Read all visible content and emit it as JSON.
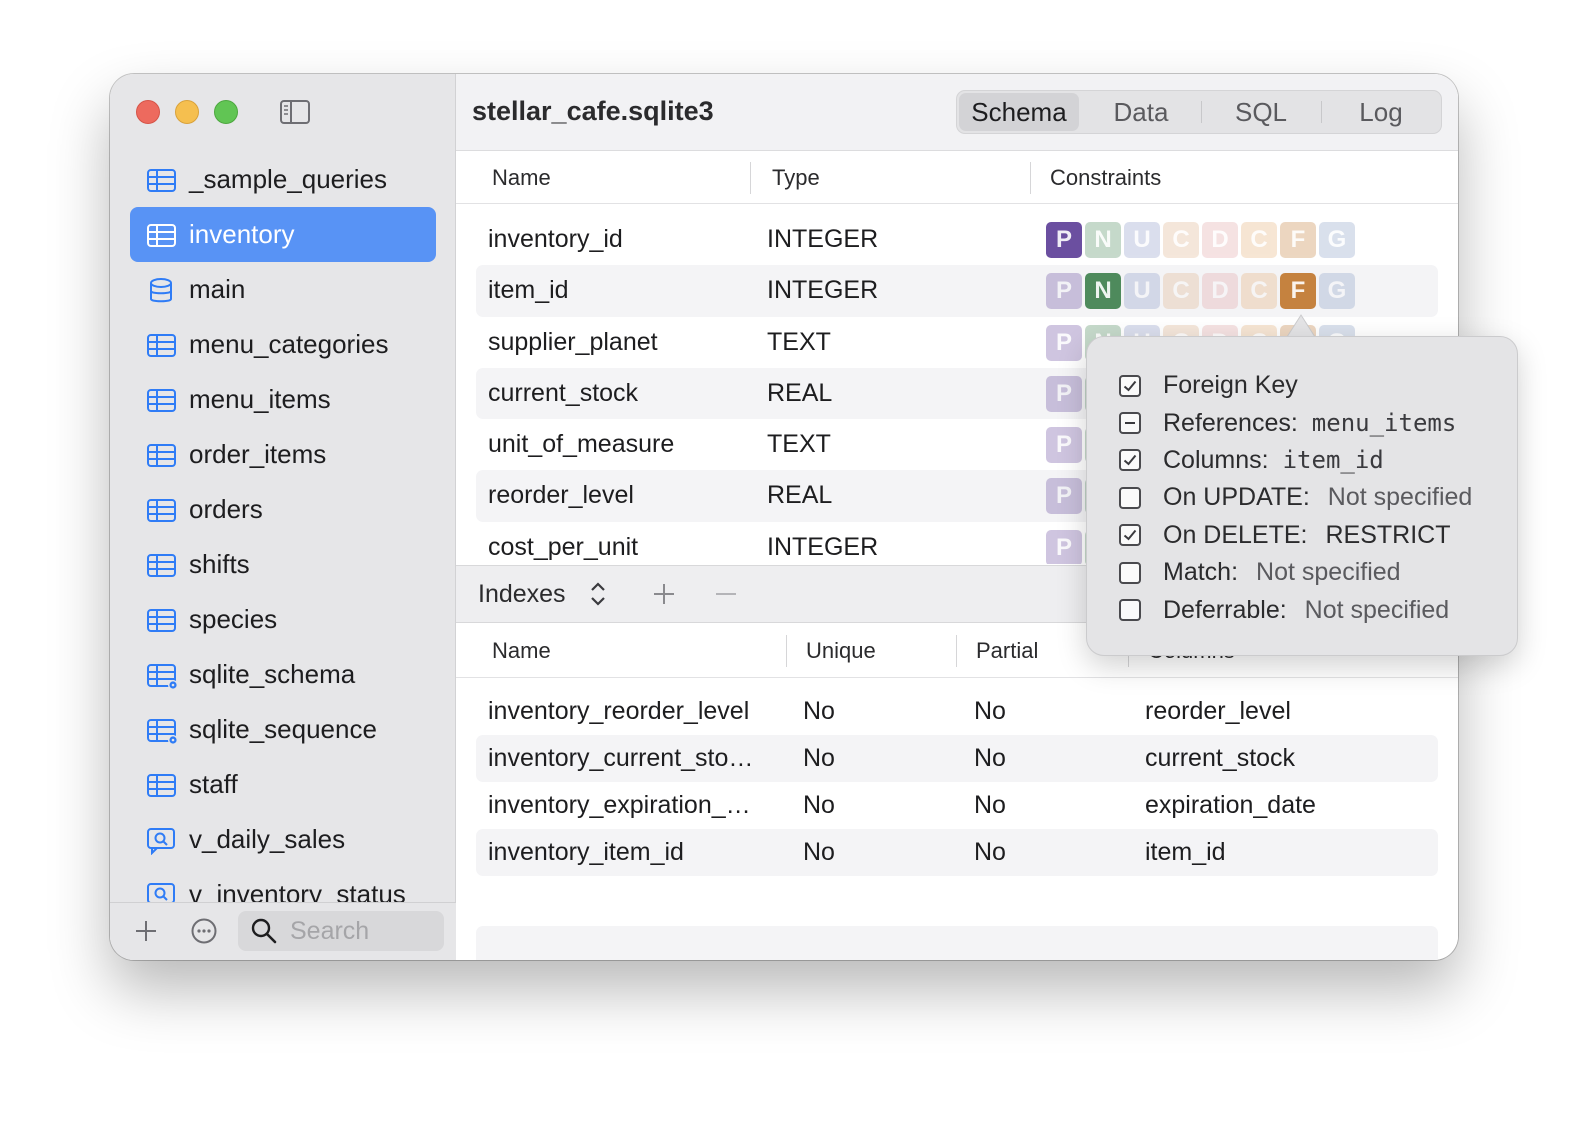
{
  "window": {
    "title": "stellar_cafe.sqlite3",
    "tabs": [
      "Schema",
      "Data",
      "SQL",
      "Log"
    ],
    "active_tab": "Schema"
  },
  "sidebar": {
    "items": [
      {
        "label": "_sample_queries",
        "icon": "table-icon"
      },
      {
        "label": "inventory",
        "icon": "table-icon",
        "selected": true
      },
      {
        "label": "main",
        "icon": "database-icon"
      },
      {
        "label": "menu_categories",
        "icon": "table-icon"
      },
      {
        "label": "menu_items",
        "icon": "table-icon"
      },
      {
        "label": "order_items",
        "icon": "table-icon"
      },
      {
        "label": "orders",
        "icon": "table-icon"
      },
      {
        "label": "shifts",
        "icon": "table-icon"
      },
      {
        "label": "species",
        "icon": "table-icon"
      },
      {
        "label": "sqlite_schema",
        "icon": "system-table-icon"
      },
      {
        "label": "sqlite_sequence",
        "icon": "system-table-icon"
      },
      {
        "label": "staff",
        "icon": "table-icon"
      },
      {
        "label": "v_daily_sales",
        "icon": "view-icon"
      },
      {
        "label": "v_inventory_status",
        "icon": "view-icon"
      }
    ],
    "search_placeholder": "Search"
  },
  "columns_table": {
    "headers": {
      "name": "Name",
      "type": "Type",
      "constraints": "Constraints"
    },
    "rows": [
      {
        "name": "inventory_id",
        "type": "INTEGER",
        "active": [
          "P"
        ]
      },
      {
        "name": "item_id",
        "type": "INTEGER",
        "active": [
          "N",
          "F"
        ]
      },
      {
        "name": "supplier_planet",
        "type": "TEXT",
        "active": []
      },
      {
        "name": "current_stock",
        "type": "REAL",
        "active": []
      },
      {
        "name": "unit_of_measure",
        "type": "TEXT",
        "active": []
      },
      {
        "name": "reorder_level",
        "type": "REAL",
        "active": []
      },
      {
        "name": "cost_per_unit",
        "type": "INTEGER",
        "active": []
      }
    ],
    "badge_letters": [
      "P",
      "N",
      "U",
      "C",
      "D",
      "C",
      "F",
      "G"
    ],
    "badge_colors": {
      "P": "#6b4fa0",
      "N": "#4e8a5c",
      "U": "#8e9cc8",
      "C1": "#e0b48e",
      "D": "#e2a6a8",
      "C2": "#e6b07a",
      "F": "#c5823f",
      "G": "#8aa0c6"
    }
  },
  "indexes": {
    "label": "Indexes",
    "headers": {
      "name": "Name",
      "unique": "Unique",
      "partial": "Partial",
      "columns": "Columns"
    },
    "rows": [
      {
        "name": "inventory_reorder_level",
        "unique": "No",
        "partial": "No",
        "columns": "reorder_level"
      },
      {
        "name": "inventory_current_sto…",
        "unique": "No",
        "partial": "No",
        "columns": "current_stock"
      },
      {
        "name": "inventory_expiration_…",
        "unique": "No",
        "partial": "No",
        "columns": "expiration_date"
      },
      {
        "name": "inventory_item_id",
        "unique": "No",
        "partial": "No",
        "columns": "item_id"
      }
    ]
  },
  "popover": {
    "items": [
      {
        "key": "Foreign Key",
        "value": "",
        "state": "checked",
        "style": "none"
      },
      {
        "key": "References:",
        "value": "menu_items",
        "state": "mixed",
        "style": "mono"
      },
      {
        "key": "Columns:",
        "value": "item_id",
        "state": "checked",
        "style": "mono"
      },
      {
        "key": "On UPDATE:",
        "value": "Not specified",
        "state": "unchecked",
        "style": "muted"
      },
      {
        "key": "On DELETE:",
        "value": "RESTRICT",
        "state": "checked",
        "style": "plain"
      },
      {
        "key": "Match:",
        "value": "Not specified",
        "state": "unchecked",
        "style": "muted"
      },
      {
        "key": "Deferrable:",
        "value": "Not specified",
        "state": "unchecked",
        "style": "muted"
      }
    ]
  }
}
